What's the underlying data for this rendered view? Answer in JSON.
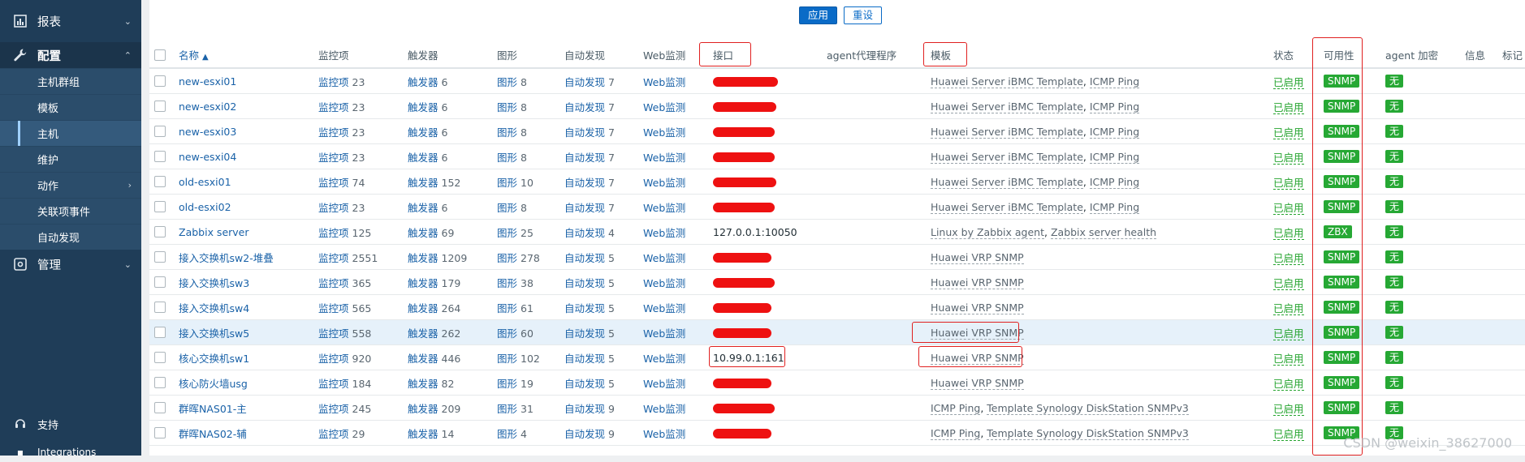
{
  "sidebar": {
    "reports": "报表",
    "config": "配置",
    "sub_items": [
      {
        "label": "主机群组"
      },
      {
        "label": "模板"
      },
      {
        "label": "主机"
      },
      {
        "label": "维护"
      },
      {
        "label": "动作"
      },
      {
        "label": "关联项事件"
      },
      {
        "label": "自动发现"
      }
    ],
    "admin": "管理",
    "support": "支持",
    "integrations": "Integrations"
  },
  "buttons": {
    "apply": "应用",
    "reset": "重设"
  },
  "table": {
    "headers": {
      "name": "名称",
      "items": "监控项",
      "triggers": "触发器",
      "graphs": "图形",
      "discovery": "自动发现",
      "web": "Web监测",
      "interface": "接口",
      "proxy": "agent代理程序",
      "templates": "模板",
      "status": "状态",
      "availability": "可用性",
      "encryption": "agent 加密",
      "info": "信息",
      "tags": "标记"
    },
    "rows": [
      {
        "name": "new-esxi01",
        "items_label": "监控项",
        "items": "23",
        "triggers_label": "触发器",
        "triggers": "6",
        "graphs_label": "图形",
        "graphs": "8",
        "discovery_label": "自动发现",
        "discovery": "7",
        "web": "Web监测",
        "interface": "",
        "templates": [
          {
            "t": "Huawei Server iBMC Template"
          },
          {
            "t": "ICMP Ping"
          }
        ],
        "status": "已启用",
        "avail": "SNMP",
        "enc": "无"
      },
      {
        "name": "new-esxi02",
        "items_label": "监控项",
        "items": "23",
        "triggers_label": "触发器",
        "triggers": "6",
        "graphs_label": "图形",
        "graphs": "8",
        "discovery_label": "自动发现",
        "discovery": "7",
        "web": "Web监测",
        "interface": "",
        "templates": [
          {
            "t": "Huawei Server iBMC Template"
          },
          {
            "t": "ICMP Ping"
          }
        ],
        "status": "已启用",
        "avail": "SNMP",
        "enc": "无"
      },
      {
        "name": "new-esxi03",
        "items_label": "监控项",
        "items": "23",
        "triggers_label": "触发器",
        "triggers": "6",
        "graphs_label": "图形",
        "graphs": "8",
        "discovery_label": "自动发现",
        "discovery": "7",
        "web": "Web监测",
        "interface": "",
        "templates": [
          {
            "t": "Huawei Server iBMC Template"
          },
          {
            "t": "ICMP Ping"
          }
        ],
        "status": "已启用",
        "avail": "SNMP",
        "enc": "无"
      },
      {
        "name": "new-esxi04",
        "items_label": "监控项",
        "items": "23",
        "triggers_label": "触发器",
        "triggers": "6",
        "graphs_label": "图形",
        "graphs": "8",
        "discovery_label": "自动发现",
        "discovery": "7",
        "web": "Web监测",
        "interface": "",
        "templates": [
          {
            "t": "Huawei Server iBMC Template"
          },
          {
            "t": "ICMP Ping"
          }
        ],
        "status": "已启用",
        "avail": "SNMP",
        "enc": "无"
      },
      {
        "name": "old-esxi01",
        "items_label": "监控项",
        "items": "74",
        "triggers_label": "触发器",
        "triggers": "152",
        "graphs_label": "图形",
        "graphs": "10",
        "discovery_label": "自动发现",
        "discovery": "7",
        "web": "Web监测",
        "interface": "",
        "templates": [
          {
            "t": "Huawei Server iBMC Template"
          },
          {
            "t": "ICMP Ping"
          }
        ],
        "status": "已启用",
        "avail": "SNMP",
        "enc": "无"
      },
      {
        "name": "old-esxi02",
        "items_label": "监控项",
        "items": "23",
        "triggers_label": "触发器",
        "triggers": "6",
        "graphs_label": "图形",
        "graphs": "8",
        "discovery_label": "自动发现",
        "discovery": "7",
        "web": "Web监测",
        "interface": "",
        "templates": [
          {
            "t": "Huawei Server iBMC Template"
          },
          {
            "t": "ICMP Ping"
          }
        ],
        "status": "已启用",
        "avail": "SNMP",
        "enc": "无"
      },
      {
        "name": "Zabbix server",
        "items_label": "监控项",
        "items": "125",
        "triggers_label": "触发器",
        "triggers": "69",
        "graphs_label": "图形",
        "graphs": "25",
        "discovery_label": "自动发现",
        "discovery": "4",
        "web": "Web监测",
        "interface": "127.0.0.1:10050",
        "templates": [
          {
            "t": "Linux by Zabbix agent"
          },
          {
            "t": "Zabbix server health"
          }
        ],
        "status": "已启用",
        "avail": "ZBX",
        "enc": "无"
      },
      {
        "name": "接入交换机sw2-堆叠",
        "items_label": "监控项",
        "items": "2551",
        "triggers_label": "触发器",
        "triggers": "1209",
        "graphs_label": "图形",
        "graphs": "278",
        "discovery_label": "自动发现",
        "discovery": "5",
        "web": "Web监测",
        "interface": "",
        "templates": [
          {
            "t": "Huawei VRP SNMP"
          }
        ],
        "status": "已启用",
        "avail": "SNMP",
        "enc": "无"
      },
      {
        "name": "接入交换机sw3",
        "items_label": "监控项",
        "items": "365",
        "triggers_label": "触发器",
        "triggers": "179",
        "graphs_label": "图形",
        "graphs": "38",
        "discovery_label": "自动发现",
        "discovery": "5",
        "web": "Web监测",
        "interface": "",
        "templates": [
          {
            "t": "Huawei VRP SNMP"
          }
        ],
        "status": "已启用",
        "avail": "SNMP",
        "enc": "无"
      },
      {
        "name": "接入交换机sw4",
        "items_label": "监控项",
        "items": "565",
        "triggers_label": "触发器",
        "triggers": "264",
        "graphs_label": "图形",
        "graphs": "61",
        "discovery_label": "自动发现",
        "discovery": "5",
        "web": "Web监测",
        "interface": "",
        "templates": [
          {
            "t": "Huawei VRP SNMP"
          }
        ],
        "status": "已启用",
        "avail": "SNMP",
        "enc": "无"
      },
      {
        "name": "接入交换机sw5",
        "items_label": "监控项",
        "items": "558",
        "triggers_label": "触发器",
        "triggers": "262",
        "graphs_label": "图形",
        "graphs": "60",
        "discovery_label": "自动发现",
        "discovery": "5",
        "web": "Web监测",
        "interface": "",
        "templates": [
          {
            "t": "Huawei VRP SNMP"
          }
        ],
        "status": "已启用",
        "avail": "SNMP",
        "enc": "无",
        "hl": true
      },
      {
        "name": "核心交换机sw1",
        "items_label": "监控项",
        "items": "920",
        "triggers_label": "触发器",
        "triggers": "446",
        "graphs_label": "图形",
        "graphs": "102",
        "discovery_label": "自动发现",
        "discovery": "5",
        "web": "Web监测",
        "interface": "10.99.0.1:161",
        "templates": [
          {
            "t": "Huawei VRP SNMP"
          }
        ],
        "status": "已启用",
        "avail": "SNMP",
        "enc": "无"
      },
      {
        "name": "核心防火墙usg",
        "items_label": "监控项",
        "items": "184",
        "triggers_label": "触发器",
        "triggers": "82",
        "graphs_label": "图形",
        "graphs": "19",
        "discovery_label": "自动发现",
        "discovery": "5",
        "web": "Web监测",
        "interface": "",
        "templates": [
          {
            "t": "Huawei VRP SNMP"
          }
        ],
        "status": "已启用",
        "avail": "SNMP",
        "enc": "无"
      },
      {
        "name": "群晖NAS01-主",
        "items_label": "监控项",
        "items": "245",
        "triggers_label": "触发器",
        "triggers": "209",
        "graphs_label": "图形",
        "graphs": "31",
        "discovery_label": "自动发现",
        "discovery": "9",
        "web": "Web监测",
        "interface": "",
        "templates": [
          {
            "t": "ICMP Ping"
          },
          {
            "t": "Template Synology DiskStation SNMPv3"
          }
        ],
        "status": "已启用",
        "avail": "SNMP",
        "enc": "无"
      },
      {
        "name": "群晖NAS02-辅",
        "items_label": "监控项",
        "items": "29",
        "triggers_label": "触发器",
        "triggers": "14",
        "graphs_label": "图形",
        "graphs": "4",
        "discovery_label": "自动发现",
        "discovery": "9",
        "web": "Web监测",
        "interface": "",
        "templates": [
          {
            "t": "ICMP Ping"
          },
          {
            "t": "Template Synology DiskStation SNMPv3"
          }
        ],
        "status": "已启用",
        "avail": "SNMP",
        "enc": "无"
      }
    ]
  },
  "watermark": "CSDN @weixin_38627000",
  "colors": {
    "sidebar": "#1f3d58",
    "link": "#1a62a8",
    "enabled": "#25a42f",
    "badge": "#26a834",
    "annotation": "#e02020"
  }
}
